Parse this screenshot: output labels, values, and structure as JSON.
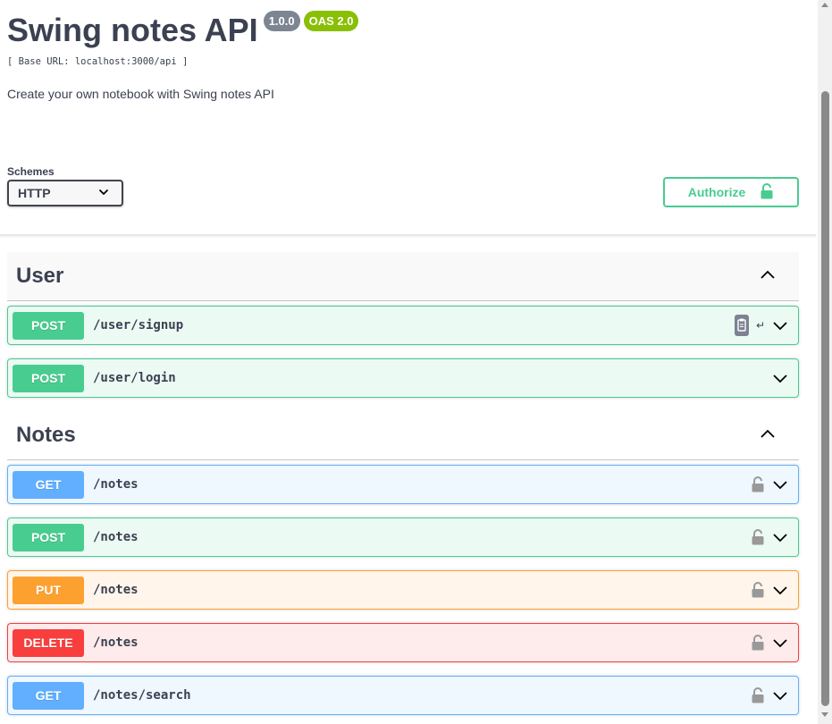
{
  "info": {
    "title": "Swing notes API",
    "version": "1.0.0",
    "oas": "OAS 2.0",
    "base_url": "[ Base URL: localhost:3000/api ]",
    "description": "Create your own notebook with Swing notes API"
  },
  "schemes": {
    "label": "Schemes",
    "selected": "HTTP"
  },
  "authorize": {
    "label": "Authorize"
  },
  "tags": [
    {
      "name": "User",
      "operations": [
        {
          "method": "POST",
          "path": "/user/signup"
        },
        {
          "method": "POST",
          "path": "/user/login"
        }
      ]
    },
    {
      "name": "Notes",
      "operations": [
        {
          "method": "GET",
          "path": "/notes"
        },
        {
          "method": "POST",
          "path": "/notes"
        },
        {
          "method": "PUT",
          "path": "/notes"
        },
        {
          "method": "DELETE",
          "path": "/notes"
        },
        {
          "method": "GET",
          "path": "/notes/search"
        }
      ]
    }
  ],
  "colors": {
    "post": "#49cc90",
    "get": "#61affe",
    "put": "#fca130",
    "delete": "#f93e3e",
    "text": "#3b4151",
    "version_badge": "#7d8492",
    "oas_badge": "#89bf04"
  },
  "icons": {
    "authorize": "unlock-icon",
    "operation_lock": "unlock-icon",
    "expand": "chevron-down-icon",
    "collapse": "chevron-up-icon",
    "copy": "copy-to-clipboard-icon"
  }
}
